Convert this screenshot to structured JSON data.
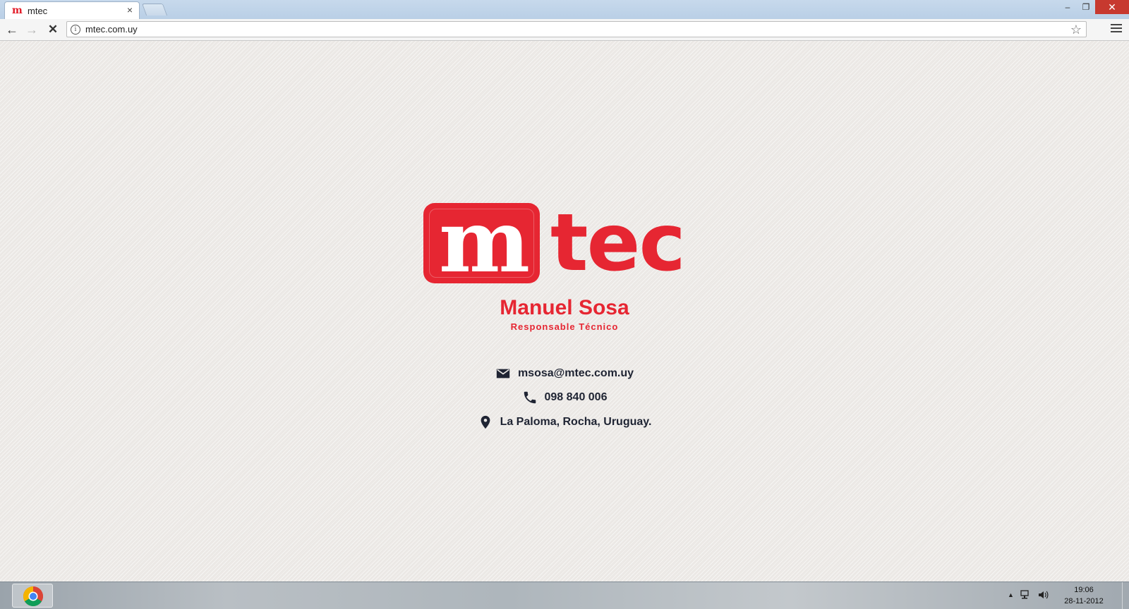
{
  "browser": {
    "tab": {
      "favicon": "m",
      "title": "mtec",
      "close": "×"
    },
    "window": {
      "minimize": "–",
      "restore": "❐",
      "close": "✕"
    },
    "nav": {
      "back": "←",
      "forward": "→",
      "stop": "✕"
    },
    "url": "mtec.com.uy",
    "icons": {
      "info": "i",
      "star": "☆"
    }
  },
  "page": {
    "logo": {
      "boxed_letter": "m",
      "rest": "tec"
    },
    "person": {
      "name": "Manuel Sosa",
      "role": "Responsable Técnico"
    },
    "contacts": [
      {
        "icon": "mail-icon",
        "text": "msosa@mtec.com.uy"
      },
      {
        "icon": "phone-icon",
        "text": "098 840 006"
      },
      {
        "icon": "location-pin-icon",
        "text": "La Paloma, Rocha, Uruguay."
      }
    ],
    "colors": {
      "brand_red": "#e62632",
      "text_dark": "#1f2433"
    }
  },
  "taskbar": {
    "tray_arrow": "▲",
    "time": "19:06",
    "date": "28-11-2012"
  }
}
